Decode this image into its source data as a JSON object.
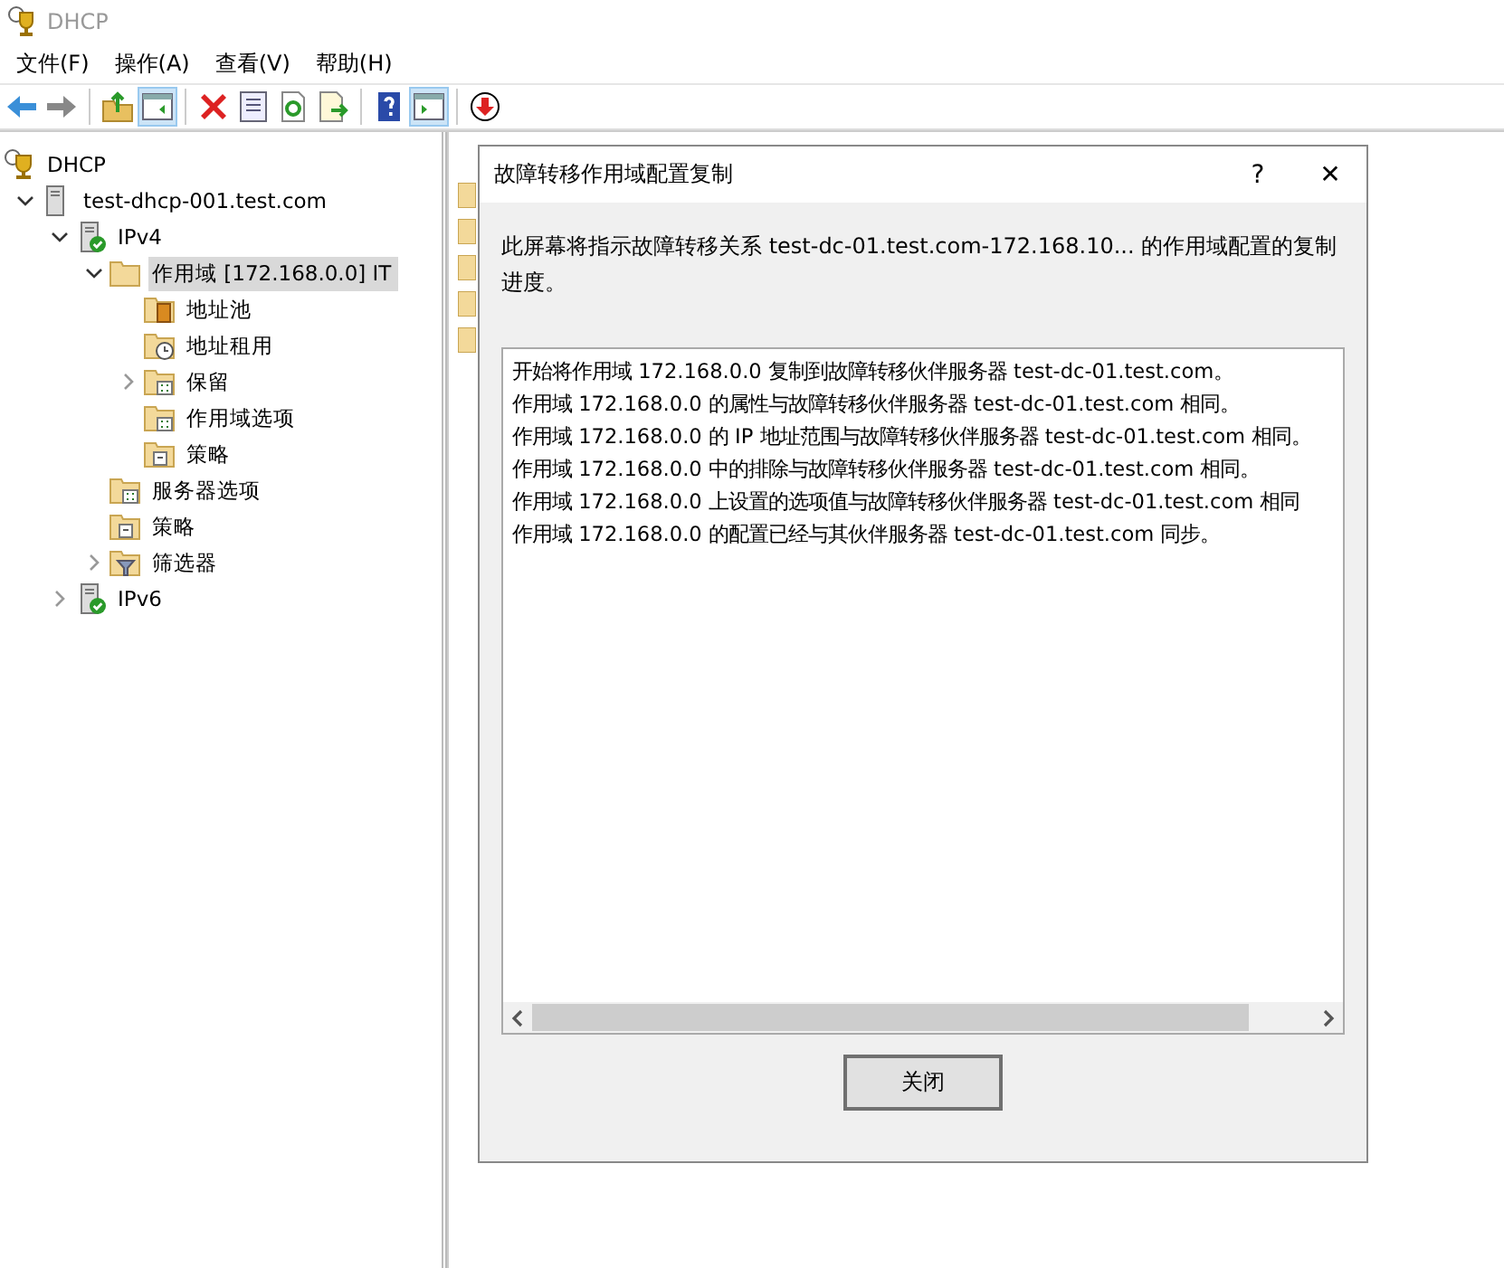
{
  "window": {
    "title": "DHCP"
  },
  "menu": [
    "文件(F)",
    "操作(A)",
    "查看(V)",
    "帮助(H)"
  ],
  "toolbar": [
    {
      "kind": "back",
      "pressed": false
    },
    {
      "kind": "forward",
      "pressed": false
    },
    {
      "kind": "separator"
    },
    {
      "kind": "up",
      "pressed": false
    },
    {
      "kind": "tree-pane",
      "pressed": true
    },
    {
      "kind": "separator"
    },
    {
      "kind": "delete",
      "pressed": false
    },
    {
      "kind": "properties",
      "pressed": false
    },
    {
      "kind": "refresh",
      "pressed": false
    },
    {
      "kind": "export",
      "pressed": false
    },
    {
      "kind": "separator"
    },
    {
      "kind": "help",
      "pressed": false
    },
    {
      "kind": "action-pane",
      "pressed": true
    },
    {
      "kind": "separator"
    },
    {
      "kind": "down",
      "pressed": false
    }
  ],
  "tree": [
    {
      "label": "DHCP",
      "kind": "dhcp",
      "selected": false,
      "children": [
        {
          "label": "test-dhcp-001.test.com",
          "kind": "server",
          "expanded": true,
          "selected": false,
          "children": [
            {
              "label": "IPv4",
              "kind": "ip",
              "expanded": true,
              "selected": false,
              "children": [
                {
                  "label": "作用域 [172.168.0.0] IT",
                  "kind": "folder",
                  "expanded": true,
                  "selected": true,
                  "children": [
                    {
                      "label": "地址池",
                      "kind": "pool",
                      "selected": false
                    },
                    {
                      "label": "地址租用",
                      "kind": "lease",
                      "selected": false
                    },
                    {
                      "label": "保留",
                      "kind": "reservation",
                      "expanded": false,
                      "selected": false
                    },
                    {
                      "label": "作用域选项",
                      "kind": "options",
                      "selected": false
                    },
                    {
                      "label": "策略",
                      "kind": "policy",
                      "selected": false
                    }
                  ]
                },
                {
                  "label": "服务器选项",
                  "kind": "options",
                  "selected": false
                },
                {
                  "label": "策略",
                  "kind": "policy",
                  "selected": false
                },
                {
                  "label": "筛选器",
                  "kind": "filter",
                  "expanded": false,
                  "selected": false
                }
              ]
            },
            {
              "label": "IPv6",
              "kind": "ip",
              "expanded": false,
              "selected": false
            }
          ]
        }
      ]
    }
  ],
  "dialog": {
    "title": "故障转移作用域配置复制",
    "help": "?",
    "close": "✕",
    "description": "此屏幕将指示故障转移关系 test-dc-01.test.com-172.168.10... 的作用域配置的复制进度。",
    "log": [
      "开始将作用域 172.168.0.0 复制到故障转移伙伴服务器 test-dc-01.test.com。",
      "作用域 172.168.0.0 的属性与故障转移伙伴服务器 test-dc-01.test.com 相同。",
      "作用域 172.168.0.0 的 IP 地址范围与故障转移伙伴服务器 test-dc-01.test.com 相同。",
      "作用域 172.168.0.0 中的排除与故障转移伙伴服务器 test-dc-01.test.com 相同。",
      "作用域 172.168.0.0 上设置的选项值与故障转移伙伴服务器 test-dc-01.test.com 相同",
      "作用域 172.168.0.0 的配置已经与其伙伴服务器 test-dc-01.test.com 同步。"
    ],
    "button": "关闭"
  }
}
